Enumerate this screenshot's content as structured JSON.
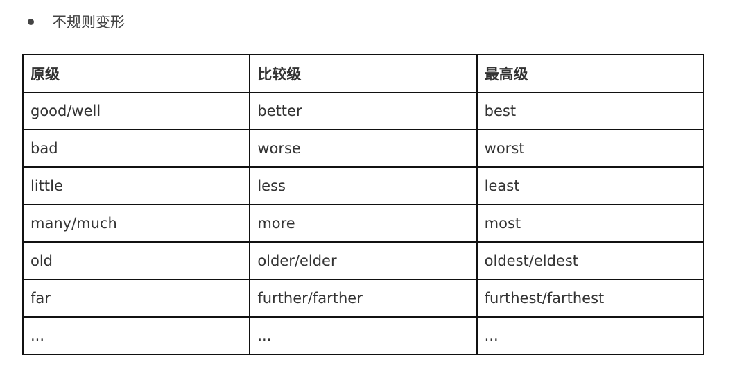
{
  "bullet": {
    "text": "不规则变形"
  },
  "table": {
    "headers": [
      "原级",
      "比较级",
      "最高级"
    ],
    "rows": [
      [
        "good/well",
        "better",
        "best"
      ],
      [
        "bad",
        "worse",
        "worst"
      ],
      [
        "little",
        "less",
        "least"
      ],
      [
        "many/much",
        "more",
        "most"
      ],
      [
        "old",
        "older/elder",
        "oldest/eldest"
      ],
      [
        "far",
        "further/farther",
        "furthest/farthest"
      ],
      [
        "...",
        "...",
        "..."
      ]
    ]
  }
}
